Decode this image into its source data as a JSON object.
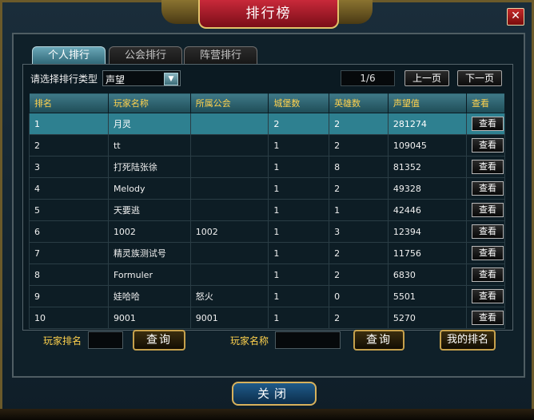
{
  "window": {
    "title": "排行榜",
    "close_icon_glyph": "✕"
  },
  "tabs": [
    {
      "label": "个人排行",
      "active": true
    },
    {
      "label": "公会排行",
      "active": false
    },
    {
      "label": "阵营排行",
      "active": false
    }
  ],
  "filter": {
    "label": "请选择排行类型",
    "selected": "声望"
  },
  "pager": {
    "page": "1/6",
    "prev_label": "上一页",
    "next_label": "下一页"
  },
  "table": {
    "headers": [
      "排名",
      "玩家名称",
      "所属公会",
      "城堡数",
      "英雄数",
      "声望值",
      "查看"
    ],
    "view_label": "查看",
    "rows": [
      {
        "rank": "1",
        "name": "月灵",
        "guild": "",
        "castles": "2",
        "heroes": "2",
        "prestige": "281274",
        "selected": true
      },
      {
        "rank": "2",
        "name": "tt",
        "guild": "",
        "castles": "1",
        "heroes": "2",
        "prestige": "109045"
      },
      {
        "rank": "3",
        "name": "打死陆张徐",
        "guild": "",
        "castles": "1",
        "heroes": "8",
        "prestige": "81352"
      },
      {
        "rank": "4",
        "name": "Melody",
        "guild": "",
        "castles": "1",
        "heroes": "2",
        "prestige": "49328"
      },
      {
        "rank": "5",
        "name": "天要逃",
        "guild": "",
        "castles": "1",
        "heroes": "1",
        "prestige": "42446"
      },
      {
        "rank": "6",
        "name": "1002",
        "guild": "1002",
        "castles": "1",
        "heroes": "3",
        "prestige": "12394"
      },
      {
        "rank": "7",
        "name": "精灵族测试号",
        "guild": "",
        "castles": "1",
        "heroes": "2",
        "prestige": "11756"
      },
      {
        "rank": "8",
        "name": "Formuler",
        "guild": "",
        "castles": "1",
        "heroes": "2",
        "prestige": "6830"
      },
      {
        "rank": "9",
        "name": "娃哈哈",
        "guild": "怒火",
        "castles": "1",
        "heroes": "0",
        "prestige": "5501"
      },
      {
        "rank": "10",
        "name": "9001",
        "guild": "9001",
        "castles": "1",
        "heroes": "2",
        "prestige": "5270"
      }
    ]
  },
  "search": {
    "rank_label": "玩家排名",
    "rank_value": "",
    "query_label": "查询",
    "name_label": "玩家名称",
    "name_value": "",
    "my_rank_label": "我的排名"
  },
  "footer": {
    "close_label": "关闭"
  },
  "colors": {
    "header_text": "#ffd24d",
    "selected_row": "#2e8090",
    "title_plate": "#c8293a"
  }
}
